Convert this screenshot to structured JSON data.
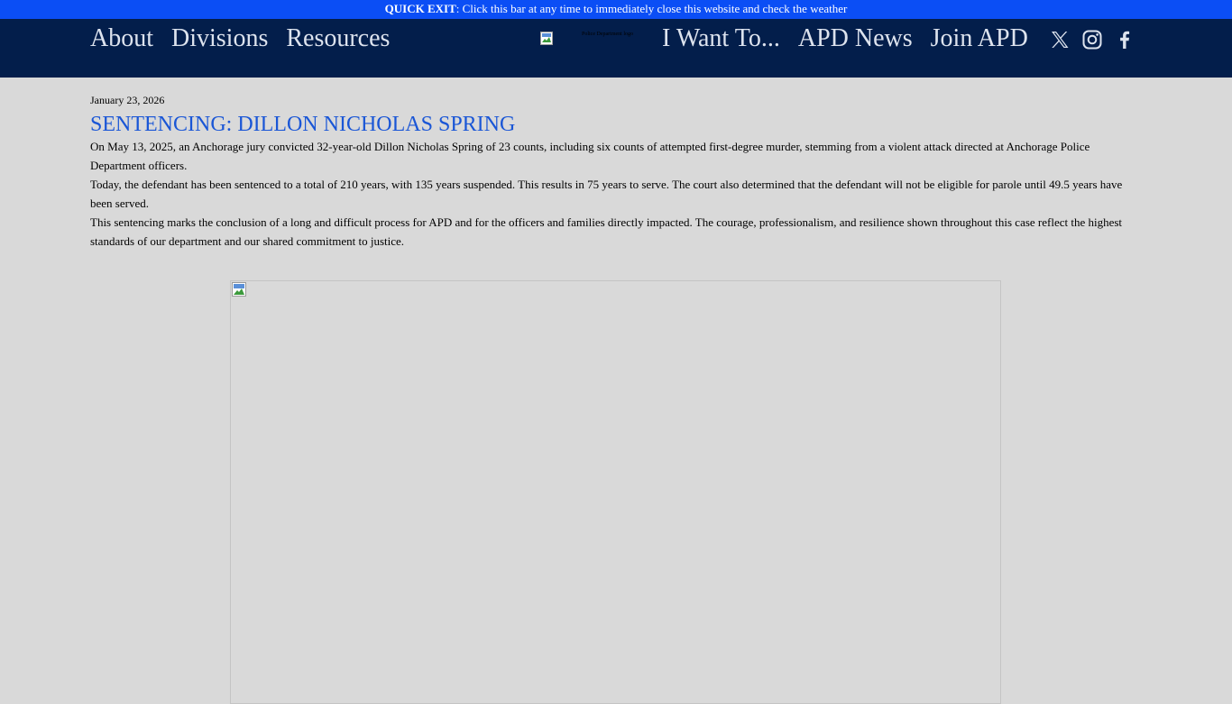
{
  "quick_exit": {
    "label": "QUICK EXIT",
    "text": ": Click this bar at any time to immediately close this website and check the weather"
  },
  "nav": {
    "left": [
      "About",
      "Divisions",
      "Resources"
    ],
    "logo_alt": "Police Department logo",
    "right": [
      "I Want To...",
      "APD News",
      "Join APD"
    ],
    "social": [
      "x-icon",
      "instagram-icon",
      "facebook-icon"
    ]
  },
  "article": {
    "date": "January 23, 2026",
    "title": "SENTENCING: DILLON NICHOLAS SPRING",
    "paragraphs": [
      "On May 13, 2025, an Anchorage jury convicted 32-year-old Dillon Nicholas Spring of 23 counts, including six counts of attempted first-degree murder, stemming from a violent attack directed at Anchorage Police Department officers.",
      "Today, the defendant has been sentenced to a total of 210 years, with 135 years suspended. This results in 75 years to serve. The court also determined that the defendant will not be eligible for parole until 49.5 years have been served.",
      "This sentencing marks the conclusion of a long and difficult process for APD and for the officers and families directly impacted. The courage, professionalism, and resilience shown throughout this case reflect the highest standards of our department and our shared commitment to justice."
    ]
  },
  "colors": {
    "quick_exit_bg": "#0b4ef5",
    "navbar_bg": "#031e4b",
    "page_bg": "#d9d9d9",
    "title": "#1a56d6"
  }
}
